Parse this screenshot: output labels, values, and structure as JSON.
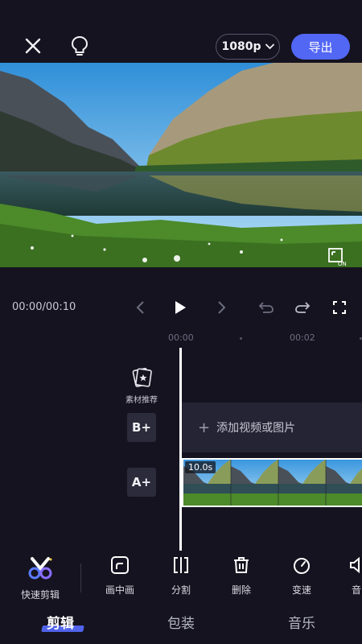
{
  "header": {
    "resolution_label": "1080p",
    "export_label": "导出",
    "accent_color": "#5367f5",
    "icons": [
      "close-icon",
      "lightbulb-icon",
      "chevron-down-icon"
    ]
  },
  "preview": {
    "scene": "mountain-lake",
    "badge_icon": "fullscreen-on-icon"
  },
  "playback": {
    "timecode": "00:00/00:10",
    "icons": [
      "prev-icon",
      "play-icon",
      "next-icon",
      "undo-icon",
      "redo-icon",
      "fullscreen-icon"
    ]
  },
  "timeline": {
    "ruler": [
      "00:00",
      "00:02"
    ],
    "material_recommend_label": "素材推荐",
    "track_b_label": "B+",
    "track_a_label": "A+",
    "add_media_label": "添加视频或图片",
    "clip_duration": "10.0s"
  },
  "tools": [
    {
      "label": "快速剪辑",
      "icon": "quick-edit-icon"
    },
    {
      "label": "画中画",
      "icon": "picture-in-picture-icon"
    },
    {
      "label": "分割",
      "icon": "split-icon"
    },
    {
      "label": "删除",
      "icon": "trash-icon"
    },
    {
      "label": "变速",
      "icon": "speed-icon"
    },
    {
      "label": "音",
      "icon": "audio-icon"
    }
  ],
  "tabs": [
    {
      "label": "剪辑",
      "active": true
    },
    {
      "label": "包装",
      "active": false
    },
    {
      "label": "音乐",
      "active": false
    }
  ]
}
